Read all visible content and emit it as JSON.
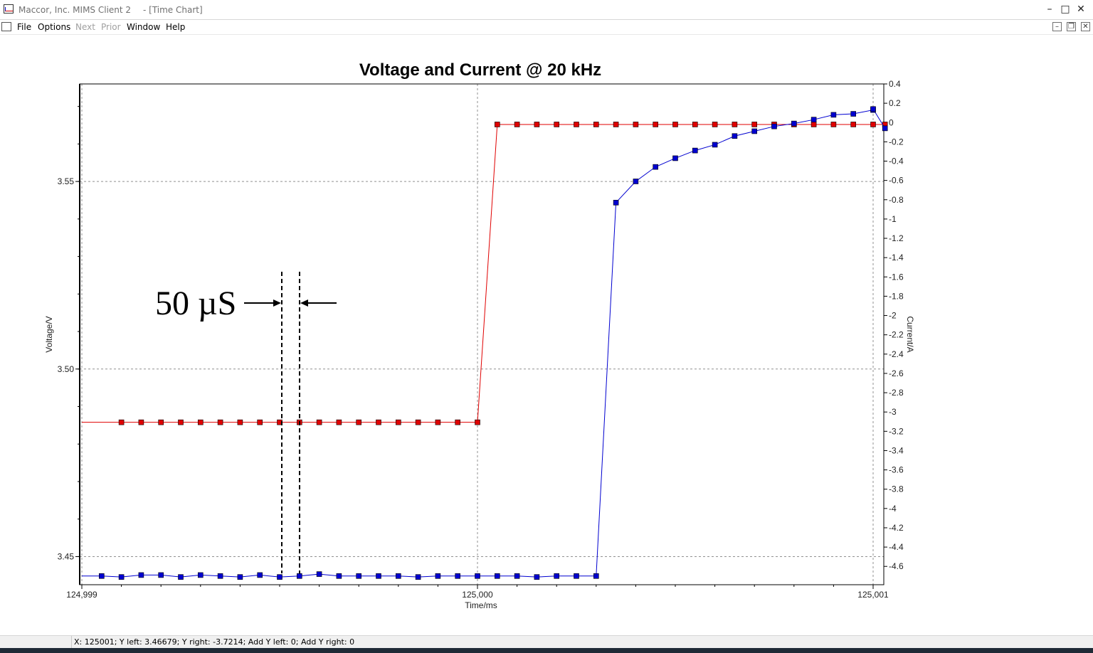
{
  "window": {
    "app_title": "Maccor, Inc. MIMS Client 2",
    "doc_title": "- [Time Chart]",
    "controls": {
      "minimize": "–",
      "maximize": "□",
      "close": "✕"
    }
  },
  "menu": {
    "file": "File",
    "options": "Options",
    "next": "Next",
    "prior": "Prior",
    "window": "Window",
    "help": "Help"
  },
  "mdi_controls": {
    "minimize": "–",
    "restore": "❐",
    "close": "✕"
  },
  "status": {
    "readout": "X: 125001; Y left: 3.46679; Y right: -3.7214; Add Y left: 0; Add Y right: 0"
  },
  "annotation": {
    "label": "50 µS"
  },
  "chart_data": {
    "type": "line",
    "title": "Voltage and Current @ 20 kHz",
    "xlabel": "Time/ms",
    "ylabel_left": "Voltage/V",
    "ylabel_right": "Current/A",
    "x_tick_labels": [
      "124,999",
      "125,000",
      "125,001"
    ],
    "xlim": [
      124999.0,
      125001.03
    ],
    "ylim_left": [
      3.4425,
      3.576
    ],
    "yticks_left": [
      "3.45",
      "3.50",
      "3.55"
    ],
    "ylim_right": [
      -4.79,
      0.4
    ],
    "yticks_right": [
      "0.4",
      "0.2",
      "0",
      "-0.2",
      "-0.4",
      "-0.6",
      "-0.8",
      "-1",
      "-1.2",
      "-1.4",
      "-1.6",
      "-1.8",
      "-2",
      "-2.2",
      "-2.4",
      "-2.6",
      "-2.8",
      "-3",
      "-3.2",
      "-3.4",
      "-3.6",
      "-3.8",
      "-4",
      "-4.2",
      "-4.4",
      "-4.6"
    ],
    "grid": true,
    "colors": {
      "voltage": "#e00000",
      "current": "#0000d0",
      "grid": "#909090"
    },
    "series": [
      {
        "axis": "left",
        "x": [
          124999.0,
          124999.1,
          124999.15,
          124999.2,
          124999.25,
          124999.3,
          124999.35,
          124999.4,
          124999.45,
          124999.5,
          124999.55,
          124999.6,
          124999.65,
          124999.7,
          124999.75,
          124999.8,
          124999.85,
          124999.9,
          124999.95,
          125000.0,
          125000.05,
          125000.1,
          125000.15,
          125000.2,
          125000.25,
          125000.3,
          125000.35,
          125000.4,
          125000.45,
          125000.5,
          125000.55,
          125000.6,
          125000.65,
          125000.7,
          125000.75,
          125000.8,
          125000.85,
          125000.9,
          125000.95,
          125001.0,
          125001.03
        ],
        "y": [
          3.4858,
          3.4858,
          3.4858,
          3.4858,
          3.4858,
          3.4858,
          3.4858,
          3.4858,
          3.4858,
          3.4858,
          3.4858,
          3.4858,
          3.4858,
          3.4858,
          3.4858,
          3.4858,
          3.4858,
          3.4858,
          3.4858,
          3.4858,
          3.5652,
          3.5652,
          3.5652,
          3.5652,
          3.5652,
          3.5652,
          3.5652,
          3.5652,
          3.5652,
          3.5652,
          3.5652,
          3.5652,
          3.5652,
          3.5652,
          3.5652,
          3.5652,
          3.5652,
          3.5652,
          3.5652,
          3.5652,
          3.5652
        ]
      },
      {
        "axis": "right",
        "x": [
          124999.0,
          124999.05,
          124999.1,
          124999.15,
          124999.2,
          124999.25,
          124999.3,
          124999.35,
          124999.4,
          124999.45,
          124999.5,
          124999.55,
          124999.6,
          124999.65,
          124999.7,
          124999.75,
          124999.8,
          124999.85,
          124999.9,
          124999.95,
          125000.0,
          125000.05,
          125000.1,
          125000.15,
          125000.2,
          125000.25,
          125000.3,
          125000.35,
          125000.4,
          125000.45,
          125000.5,
          125000.55,
          125000.6,
          125000.65,
          125000.7,
          125000.75,
          125000.8,
          125000.85,
          125000.9,
          125000.95,
          125001.0,
          125001.0,
          125001.03
        ],
        "y": [
          -4.7,
          -4.7,
          -4.71,
          -4.69,
          -4.69,
          -4.71,
          -4.69,
          -4.7,
          -4.71,
          -4.69,
          -4.71,
          -4.7,
          -4.68,
          -4.7,
          -4.7,
          -4.7,
          -4.7,
          -4.71,
          -4.7,
          -4.7,
          -4.7,
          -4.7,
          -4.7,
          -4.71,
          -4.7,
          -4.7,
          -4.7,
          -0.83,
          -0.61,
          -0.46,
          -0.37,
          -0.29,
          -0.23,
          -0.14,
          -0.09,
          -0.04,
          -0.01,
          0.03,
          0.08,
          0.09,
          0.13,
          0.14,
          -0.06
        ]
      }
    ]
  }
}
